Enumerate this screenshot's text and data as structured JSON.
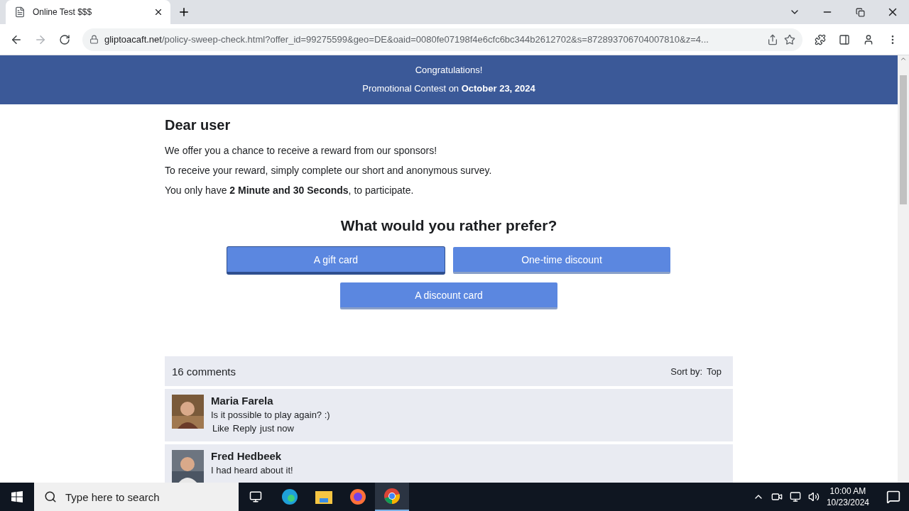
{
  "browser": {
    "tab_title": "Online Test $$$",
    "url_host": "gliptoacaft.net",
    "url_path": "/policy-sweep-check.html?offer_id=99275599&geo=DE&oaid=0080fe07198f4e6cfc6bc344b2612702&s=872893706704007810&z=4..."
  },
  "banner": {
    "line_1": "Congratulations!",
    "line_2": "Promotional Contest on **October 23, 2024**"
  },
  "intro": {
    "heading": "Dear user",
    "paragraphs": [
      "We offer you a chance to receive a reward from our sponsors!",
      "To receive your reward, simply complete our short and anonymous survey.",
      "You only have **2 Minute and 30 Seconds**, to participate."
    ]
  },
  "question": {
    "title": "What would you rather prefer?",
    "choices": [
      {
        "label": "A gift card",
        "selected": true
      },
      {
        "label": "One-time discount",
        "selected": false
      },
      {
        "label": "A discount card",
        "selected": false
      }
    ]
  },
  "comments": {
    "count": "16 comments",
    "sort_label": "Sort by:",
    "sort_value": "Top",
    "items": [
      {
        "author": "Maria Farela",
        "text": "Is it possible to play again? :)",
        "like": "Like",
        "reply": "Reply",
        "time": "just now"
      },
      {
        "author": "Fred Hedbeek",
        "text": "I had heard about it!"
      }
    ]
  },
  "taskbar": {
    "search_placeholder": "Type here to search",
    "time": "10:00 AM",
    "date": "10/23/2024"
  }
}
